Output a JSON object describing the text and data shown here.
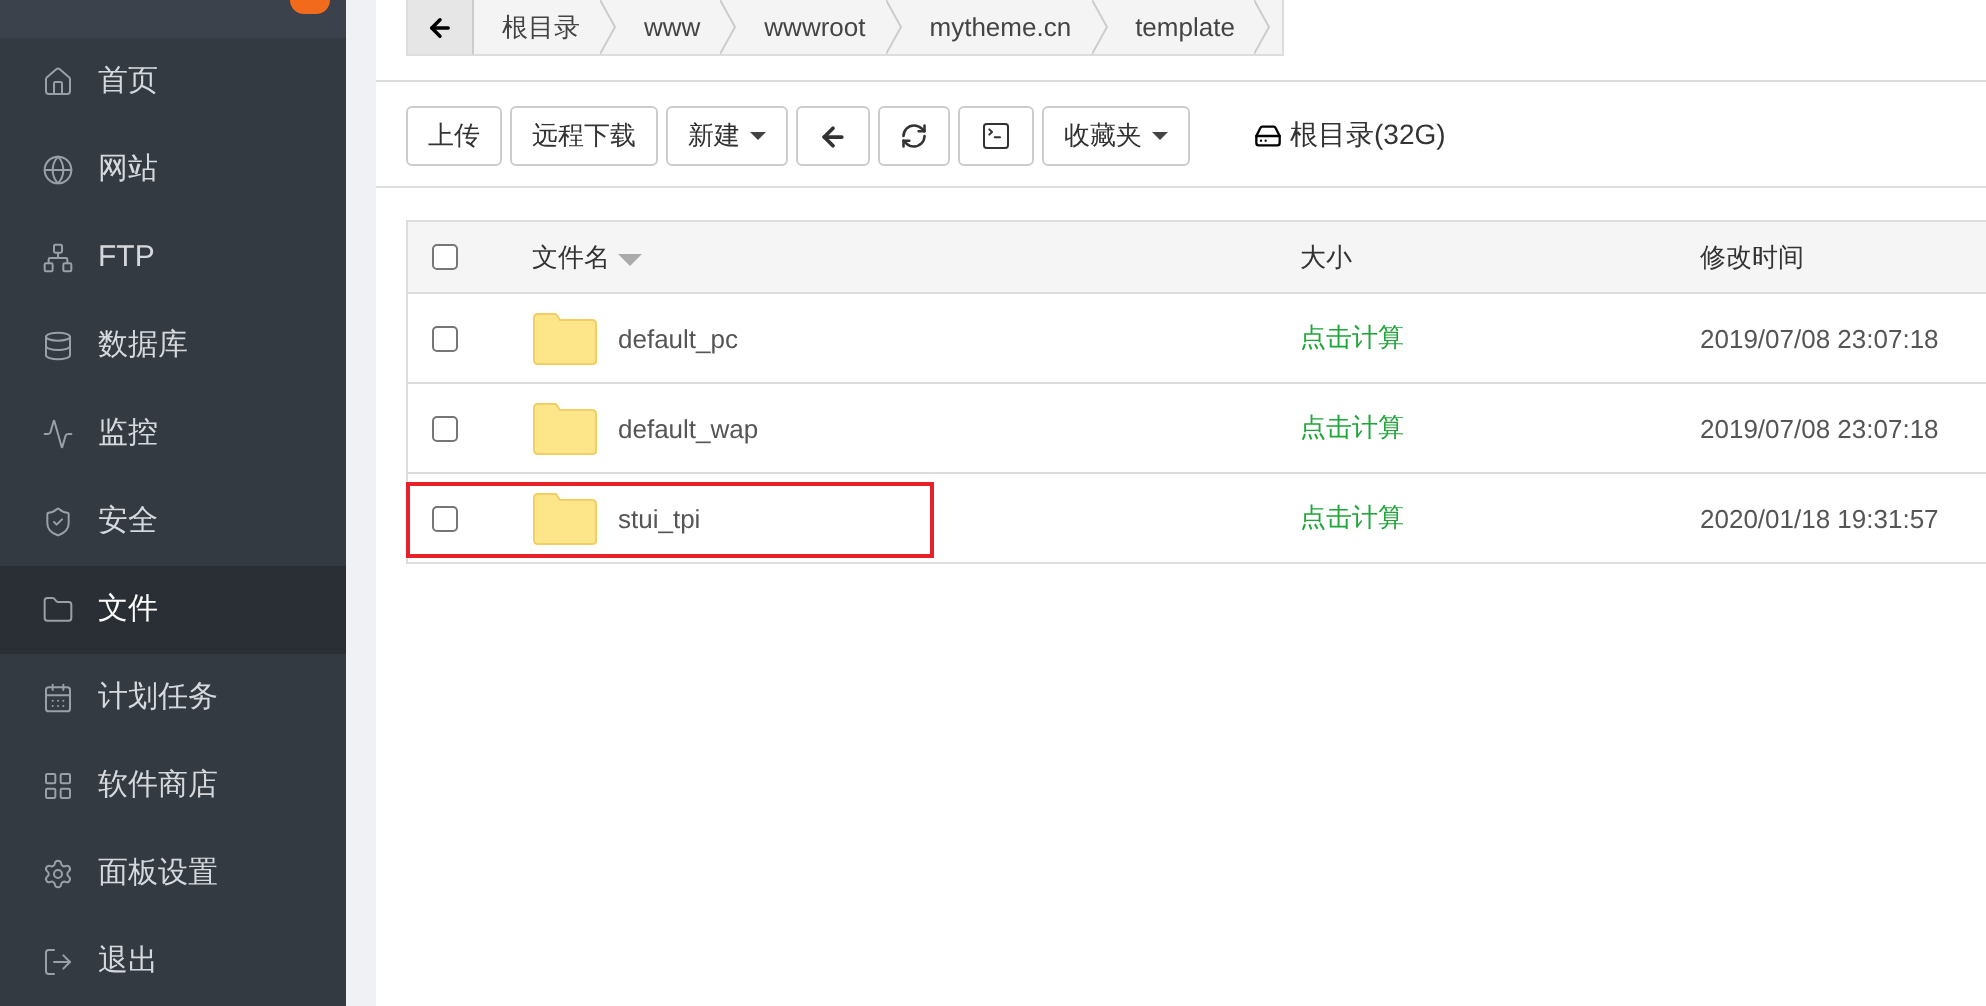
{
  "sidebar": {
    "items": [
      {
        "label": "首页",
        "selected": false
      },
      {
        "label": "网站",
        "selected": false
      },
      {
        "label": "FTP",
        "selected": false
      },
      {
        "label": "数据库",
        "selected": false
      },
      {
        "label": "监控",
        "selected": false
      },
      {
        "label": "安全",
        "selected": false
      },
      {
        "label": "文件",
        "selected": true
      },
      {
        "label": "计划任务",
        "selected": false
      },
      {
        "label": "软件商店",
        "selected": false
      },
      {
        "label": "面板设置",
        "selected": false
      },
      {
        "label": "退出",
        "selected": false
      }
    ]
  },
  "breadcrumb": [
    "根目录",
    "www",
    "wwwroot",
    "mytheme.cn",
    "template"
  ],
  "toolbar": [
    {
      "kind": "text",
      "label": "上传"
    },
    {
      "kind": "text",
      "label": "远程下载"
    },
    {
      "kind": "dropdown",
      "label": "新建"
    },
    {
      "kind": "back"
    },
    {
      "kind": "refresh"
    },
    {
      "kind": "terminal"
    },
    {
      "kind": "dropdown",
      "label": "收藏夹"
    }
  ],
  "disk": "根目录(32G)",
  "table": {
    "columns": [
      "文件名",
      "大小",
      "修改时间"
    ],
    "header_checked": false,
    "rows": [
      {
        "name": "default_pc",
        "size": "点击计算",
        "modified": "2019/07/08 23:07:18",
        "checked": false,
        "highlighted": false
      },
      {
        "name": "default_wap",
        "size": "点击计算",
        "modified": "2019/07/08 23:07:18",
        "checked": false,
        "highlighted": false
      },
      {
        "name": "stui_tpi",
        "size": "点击计算",
        "modified": "2020/01/18 19:31:57",
        "checked": false,
        "highlighted": true
      }
    ]
  }
}
